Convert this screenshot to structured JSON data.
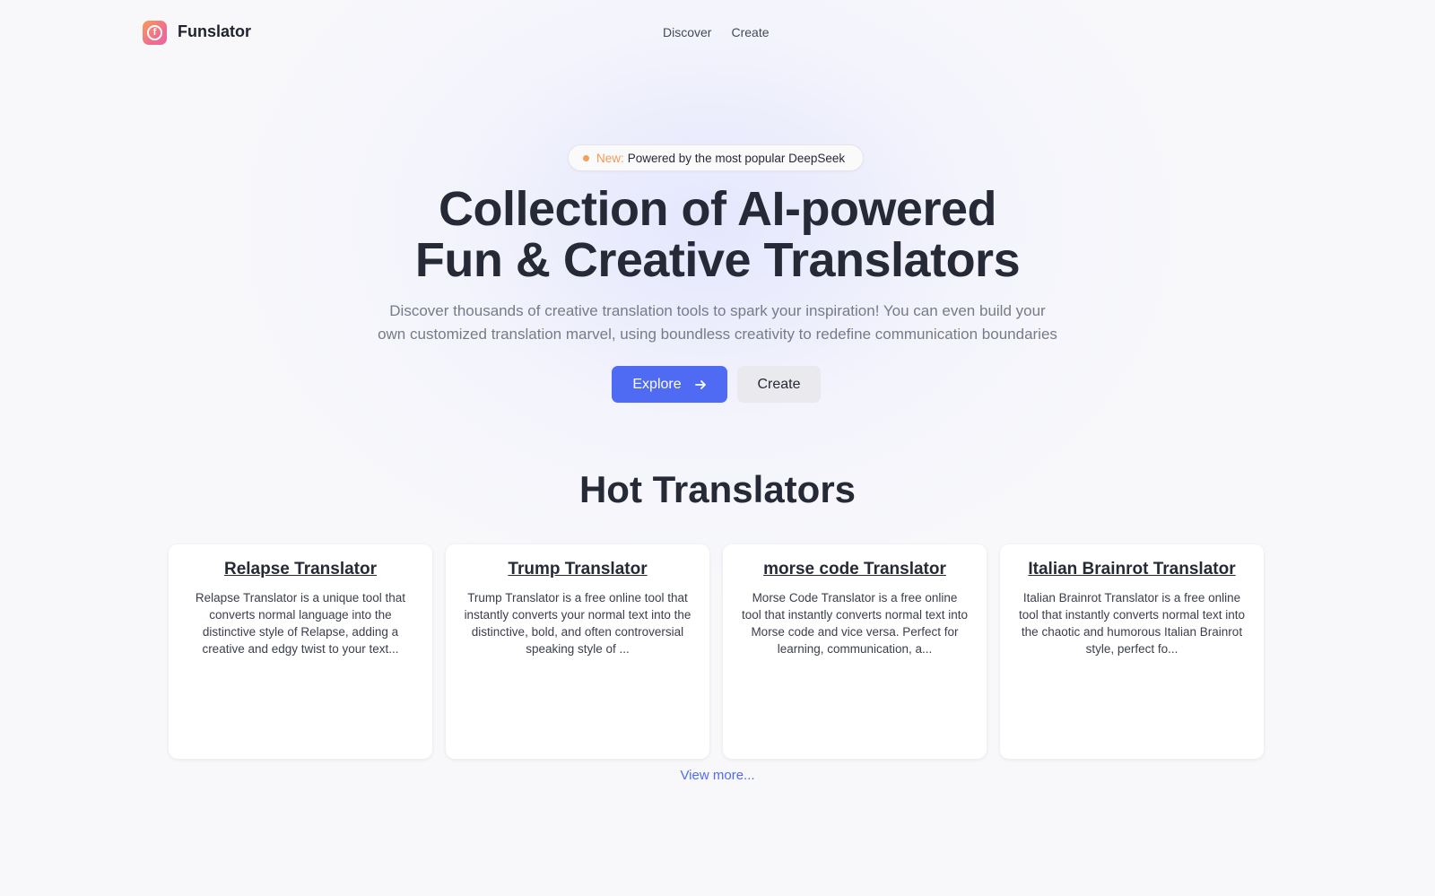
{
  "header": {
    "brand": "Funslator",
    "nav": [
      "Discover",
      "Create"
    ]
  },
  "hero": {
    "badge_new": "New:",
    "badge_text": "Powered by the most popular DeepSeek",
    "title_line1": "Collection of AI-powered",
    "title_line2": "Fun & Creative Translators",
    "subtitle_line1": "Discover thousands of creative translation tools to spark your inspiration! You can even build your",
    "subtitle_line2": "own customized translation marvel, using boundless creativity to redefine communication boundaries",
    "explore_label": "Explore",
    "create_label": "Create"
  },
  "hot": {
    "title": "Hot Translators",
    "cards": [
      {
        "title": "Relapse Translator",
        "desc": "Relapse Translator is a unique tool that converts normal language into the distinctive style of Relapse, adding a creative and edgy twist to your text..."
      },
      {
        "title": "Trump Translator",
        "desc": "Trump Translator is a free online tool that instantly converts your normal text into the distinctive, bold, and often controversial speaking style of ..."
      },
      {
        "title": "morse code Translator",
        "desc": "Morse Code Translator is a free online tool that instantly converts normal text into Morse code and vice versa. Perfect for learning, communication, a..."
      },
      {
        "title": "Italian Brainrot Translator",
        "desc": "Italian Brainrot Translator is a free online tool that instantly converts normal text into the chaotic and humorous Italian Brainrot style, perfect fo..."
      }
    ],
    "view_more": "View more..."
  },
  "colors": {
    "accent": "#4f6bf4",
    "badge_new": "#ef9a55",
    "text": "#262a36"
  },
  "icons": {
    "logo": "funslator-logo-icon",
    "explore_arrow": "arrow-right-icon"
  }
}
